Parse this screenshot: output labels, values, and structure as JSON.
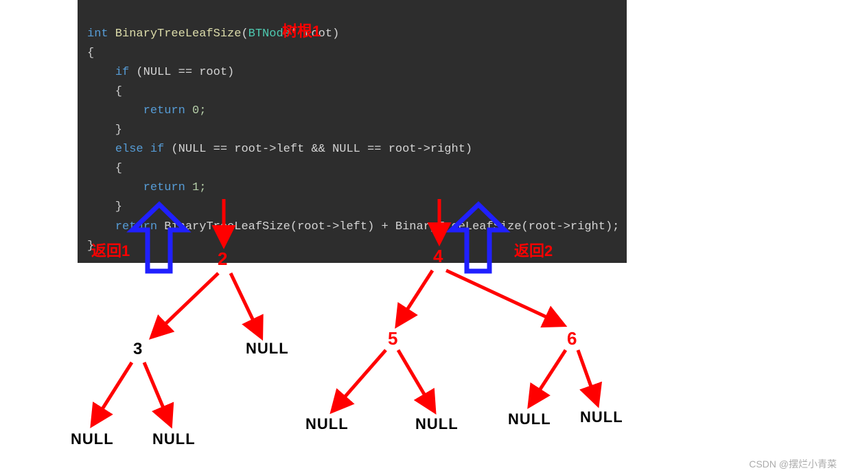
{
  "code": {
    "line1_int": "int",
    "line1_fn": " BinaryTreeLeafSize",
    "line1_sig": "(",
    "line1_type": "BTNode",
    "line1_sig2": "* root)",
    "brace_open": "{",
    "if_kw": "if",
    "if_cond": " (NULL == root)",
    "brace_inner": "{",
    "return0": "        return 0;",
    "ret_kw": "return",
    "ret_zero": " 0;",
    "brace_close_inner": "}",
    "elseif_kw": "else if",
    "elseif_cond": " (NULL == root->left && NULL == root->right)",
    "return1_kw": "return",
    "return1_val": " 1;",
    "final_ret_kw": "return",
    "final_ret_body": " BinaryTreeLeafSize(root->left) + BinaryTreeLeafSize(root->right);",
    "brace_final": "}"
  },
  "labels": {
    "root1": "树根1",
    "return1": "返回1",
    "return2": "返回2"
  },
  "nodes": {
    "n2": "2",
    "n3": "3",
    "n4": "4",
    "n5": "5",
    "n6": "6",
    "null": "NULL"
  },
  "watermark": "CSDN @摆烂小青菜",
  "chart_data": {
    "type": "tree",
    "description": "Recursion trace of BinaryTreeLeafSize",
    "root": {
      "value": 1,
      "label": "树根1",
      "left": {
        "value": 2,
        "returns": 1,
        "left": {
          "value": 3,
          "left": "NULL",
          "right": "NULL"
        },
        "right": "NULL"
      },
      "right": {
        "value": 4,
        "returns": 2,
        "left": {
          "value": 5,
          "left": "NULL",
          "right": "NULL"
        },
        "right": {
          "value": 6,
          "left": "NULL",
          "right": "NULL"
        }
      }
    }
  }
}
